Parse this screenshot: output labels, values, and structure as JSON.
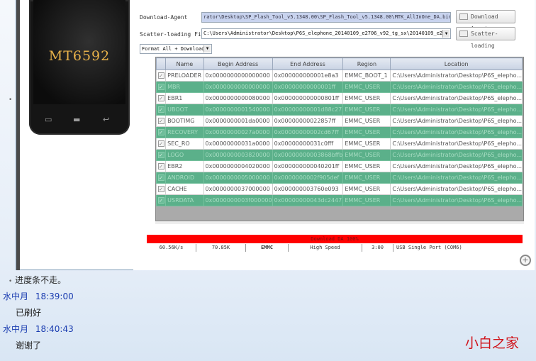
{
  "phone": {
    "chip_label": "MT6592"
  },
  "form": {
    "download_agent_label": "Download-Agent",
    "download_agent_path": "rator\\Desktop\\SP_Flash_Tool_v5.1348.00\\SP_Flash_Tool_v5.1348.00\\MTK_AllInOne_DA.bin",
    "download_agent_button": "Download Agent",
    "scatter_label": "Scatter-loading File",
    "scatter_path": "C:\\Users\\Administrator\\Desktop\\P6S_elephone_20140109_e2706_v92_tg_sx\\20140109_e27",
    "scatter_button": "Scatter-loading",
    "mode_select": "Format All + Download"
  },
  "table": {
    "headers": [
      "",
      "Name",
      "Begin Address",
      "End Address",
      "Region",
      "Location"
    ],
    "rows": [
      {
        "style": "white",
        "name": "PRELOADER",
        "begin": "0x0000000000000000",
        "end": "0x000000000001e8a3",
        "region": "EMMC_BOOT_1",
        "location": "C:\\Users\\Administrator\\Desktop\\P6S_elepho..."
      },
      {
        "style": "green",
        "name": "MBR",
        "begin": "0x0000000000000000",
        "end": "0x00000000000001ff",
        "region": "EMMC_USER",
        "location": "C:\\Users\\Administrator\\Desktop\\P6S_elepho..."
      },
      {
        "style": "white",
        "name": "EBR1",
        "begin": "0x0000000000080000",
        "end": "0x000000000000801ff",
        "region": "EMMC_USER",
        "location": "C:\\Users\\Administrator\\Desktop\\P6S_elepho..."
      },
      {
        "style": "green",
        "name": "UBOOT",
        "begin": "0x0000000001540000",
        "end": "0x00000000001d88c27",
        "region": "EMMC_USER",
        "location": "C:\\Users\\Administrator\\Desktop\\P6S_elepho..."
      },
      {
        "style": "white",
        "name": "BOOTIMG",
        "begin": "0x0000000001da0000",
        "end": "0x00000000022857ff",
        "region": "EMMC_USER",
        "location": "C:\\Users\\Administrator\\Desktop\\P6S_elepho..."
      },
      {
        "style": "green",
        "name": "RECOVERY",
        "begin": "0x00000000027a0000",
        "end": "0x00000000002cd67ff",
        "region": "EMMC_USER",
        "location": "C:\\Users\\Administrator\\Desktop\\P6S_elepho..."
      },
      {
        "style": "white",
        "name": "SEC_RO",
        "begin": "0x00000000031a0000",
        "end": "0x00000000031c0fff",
        "region": "EMMC_USER",
        "location": "C:\\Users\\Administrator\\Desktop\\P6S_elepho..."
      },
      {
        "style": "green",
        "name": "LOGO",
        "begin": "0x0000000003820000",
        "end": "0x00000000003868bffb",
        "region": "EMMC_USER",
        "location": "C:\\Users\\Administrator\\Desktop\\P6S_elepho..."
      },
      {
        "style": "white",
        "name": "EBR2",
        "begin": "0x0000000004020000",
        "end": "0x000000000040201ff",
        "region": "EMMC_USER",
        "location": "C:\\Users\\Administrator\\Desktop\\P6S_elepho..."
      },
      {
        "style": "green",
        "name": "ANDROID",
        "begin": "0x0000000005000000",
        "end": "0x0000000002f905def",
        "region": "EMMC_USER",
        "location": "C:\\Users\\Administrator\\Desktop\\P6S_elepho..."
      },
      {
        "style": "white",
        "name": "CACHE",
        "begin": "0x0000000037000000",
        "end": "0x000000003760e093",
        "region": "EMMC_USER",
        "location": "C:\\Users\\Administrator\\Desktop\\P6S_elepho..."
      },
      {
        "style": "green",
        "name": "USRDATA",
        "begin": "0x0000000003f000000",
        "end": "0x00000000043dc2447",
        "region": "EMMC_USER",
        "location": "C:\\Users\\Administrator\\Desktop\\P6S_elepho..."
      }
    ]
  },
  "progress": {
    "text": "Download DA 100%",
    "fraction": 1.0
  },
  "status": {
    "speed": "60.56K/s",
    "size": "70.85K",
    "storage": "EMMC",
    "mode": "High Speed",
    "time": "3:00",
    "port": "USB Single Port (COM6)"
  },
  "chat": {
    "line1": "进度条不走。",
    "sender1": "水中月",
    "time1": "18:39:00",
    "msg1": "已刷好",
    "sender2": "水中月",
    "time2": "18:40:43",
    "msg2": "谢谢了"
  },
  "watermark": "小白之家",
  "colors": {
    "row_green": "#5bb08a",
    "progress_red": "#ff0000",
    "sender_blue": "#1a3cb0",
    "watermark_red": "#d0141b"
  },
  "icons": {
    "zoom": "zoom-in-icon",
    "checkbox": "checkbox-icon"
  }
}
